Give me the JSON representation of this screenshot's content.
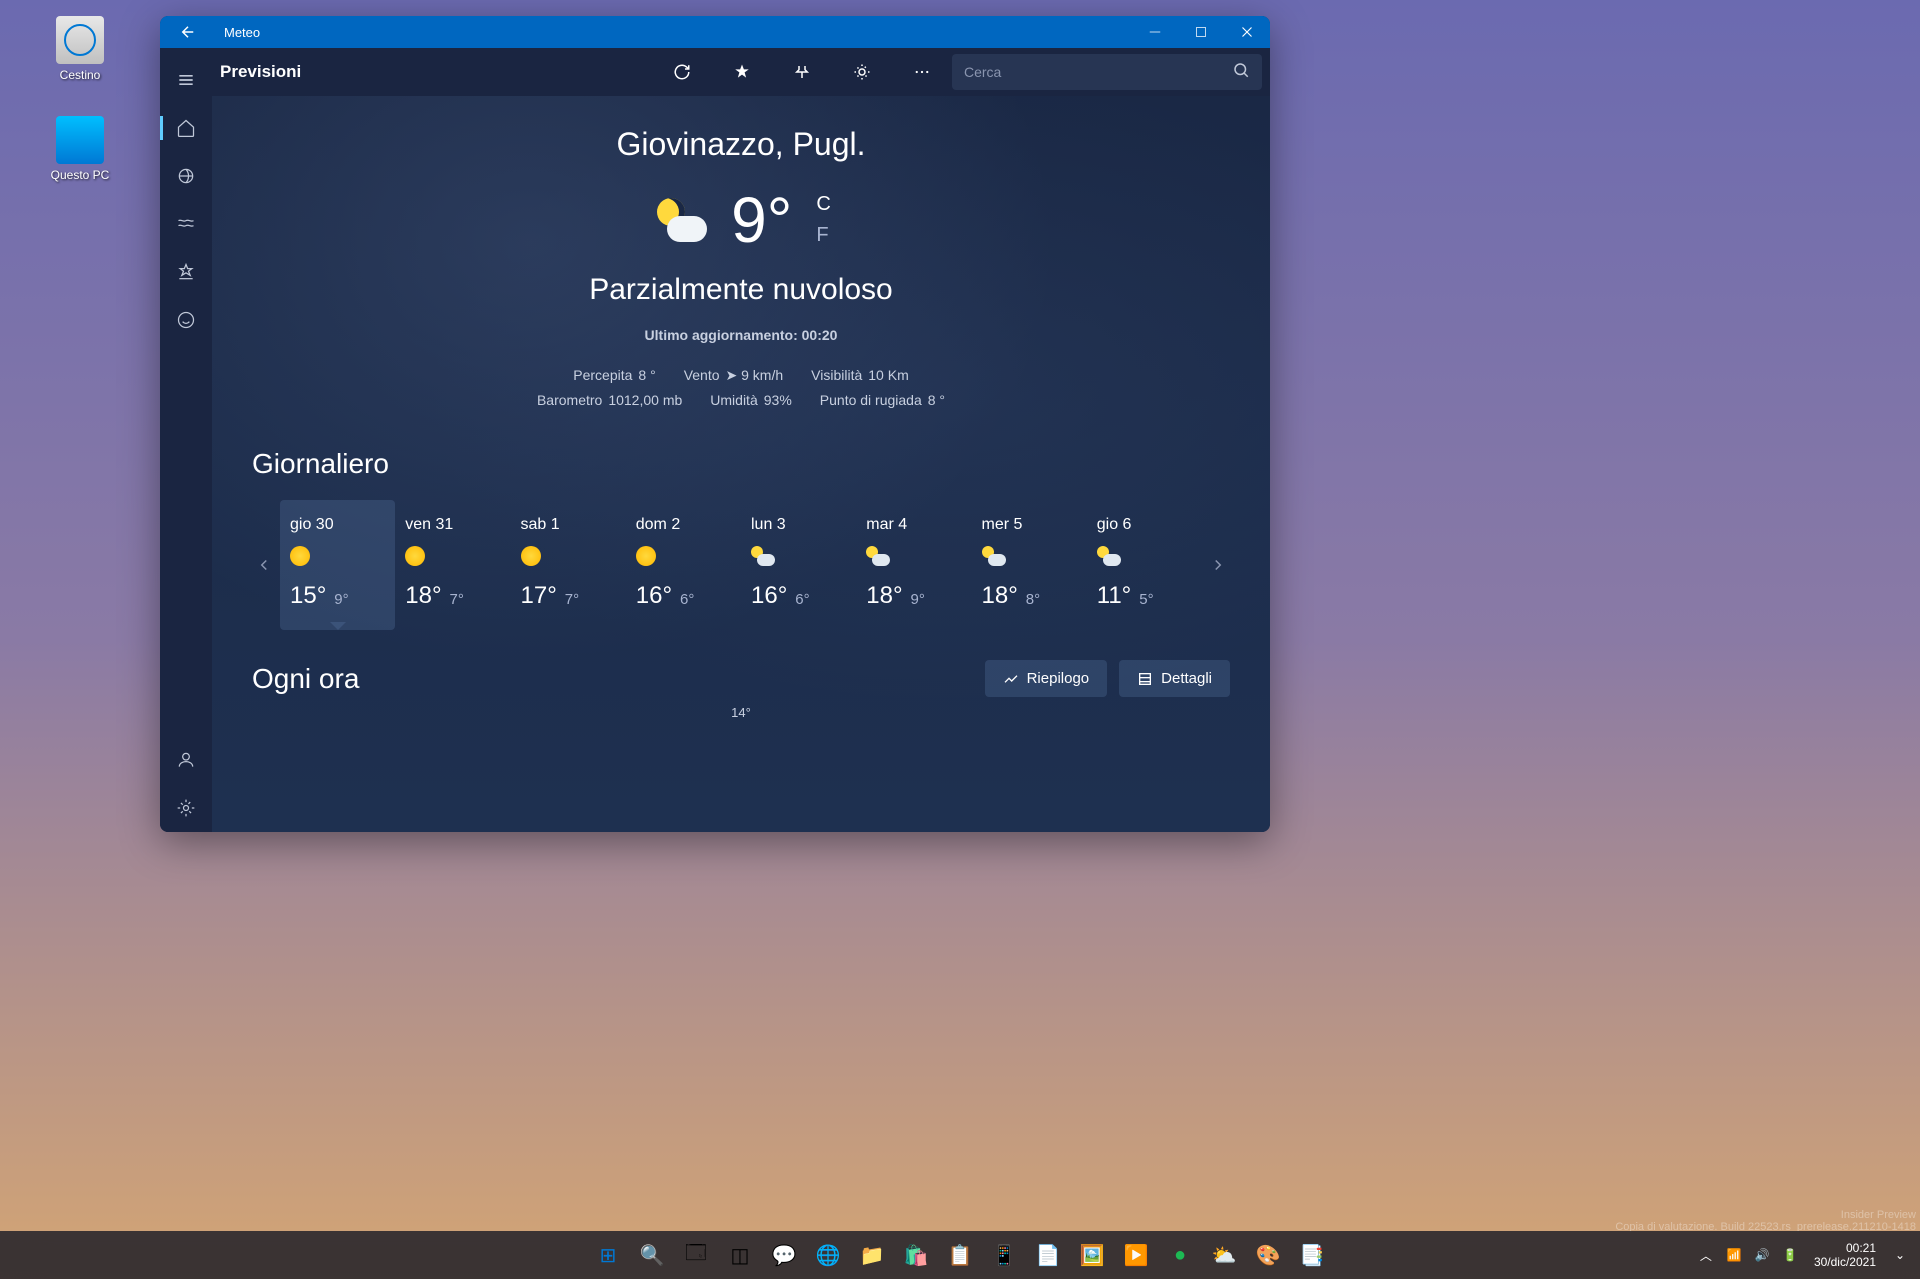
{
  "desktop": {
    "recycle_bin": "Cestino",
    "this_pc": "Questo PC"
  },
  "window": {
    "title": "Meteo",
    "page_title": "Previsioni",
    "search_placeholder": "Cerca"
  },
  "current": {
    "location": "Giovinazzo, Pugl.",
    "temp": "9°",
    "unit_c": "C",
    "unit_f": "F",
    "condition": "Parzialmente nuvoloso",
    "updated": "Ultimo aggiornamento: 00:20"
  },
  "details": {
    "feels_label": "Percepita",
    "feels_val": "8 °",
    "wind_label": "Vento",
    "wind_val": "➤ 9 km/h",
    "vis_label": "Visibilità",
    "vis_val": "10 Km",
    "baro_label": "Barometro",
    "baro_val": "1012,00 mb",
    "hum_label": "Umidità",
    "hum_val": "93%",
    "dew_label": "Punto di rugiada",
    "dew_val": "8 °"
  },
  "daily": {
    "title": "Giornaliero",
    "days": [
      {
        "label": "gio 30",
        "high": "15°",
        "low": "9°",
        "icon": "sun"
      },
      {
        "label": "ven 31",
        "high": "18°",
        "low": "7°",
        "icon": "sun"
      },
      {
        "label": "sab 1",
        "high": "17°",
        "low": "7°",
        "icon": "sun"
      },
      {
        "label": "dom 2",
        "high": "16°",
        "low": "6°",
        "icon": "sun"
      },
      {
        "label": "lun 3",
        "high": "16°",
        "low": "6°",
        "icon": "cloud-sun"
      },
      {
        "label": "mar 4",
        "high": "18°",
        "low": "9°",
        "icon": "cloud-sun"
      },
      {
        "label": "mer 5",
        "high": "18°",
        "low": "8°",
        "icon": "cloud-sun"
      },
      {
        "label": "gio 6",
        "high": "11°",
        "low": "5°",
        "icon": "cloud-sun"
      }
    ]
  },
  "hourly": {
    "title": "Ogni ora",
    "summary_btn": "Riepilogo",
    "details_btn": "Dettagli",
    "temp_marker": "14°"
  },
  "eval": {
    "preview": "Insider Preview",
    "build": "Copia di valutazione. Build 22523.rs_prerelease.211210-1418"
  },
  "taskbar": {
    "time": "00:21",
    "date": "30/dic/2021"
  }
}
